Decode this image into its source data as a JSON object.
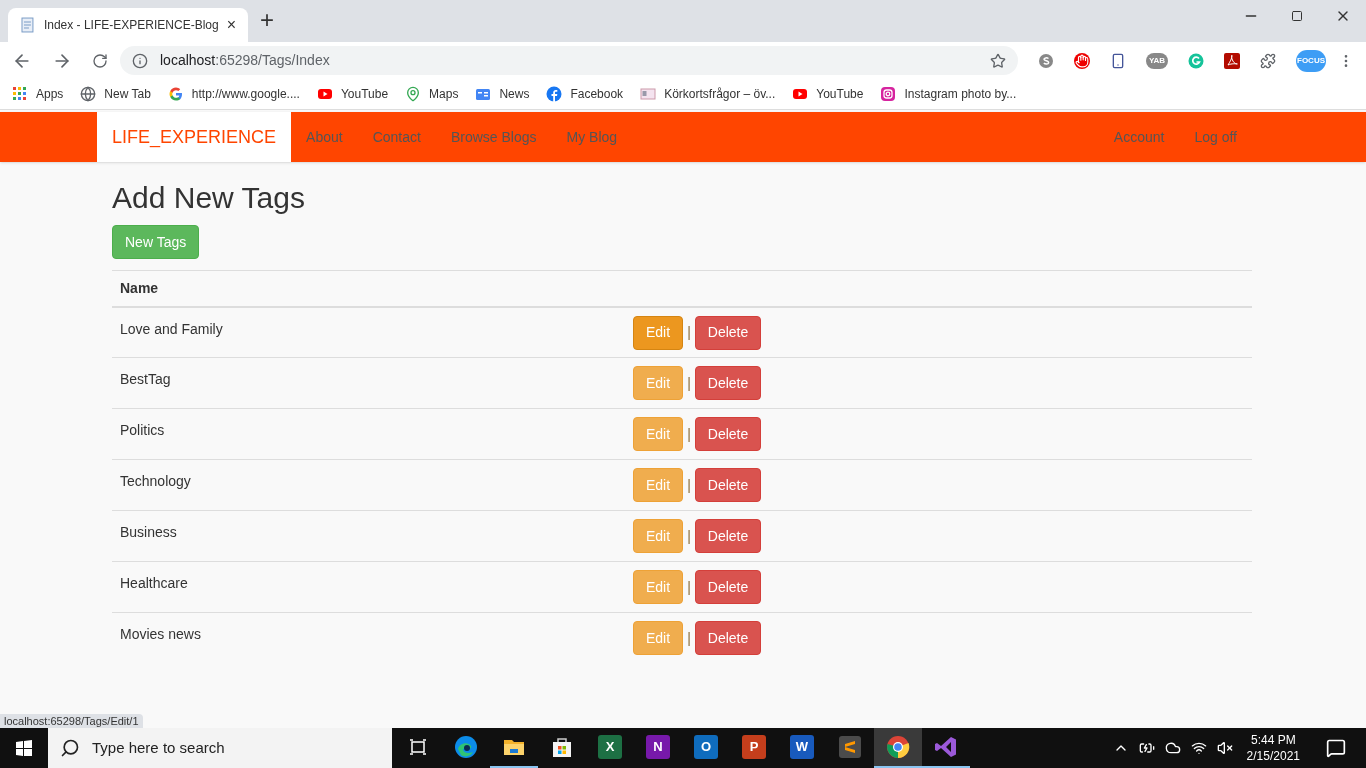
{
  "browser": {
    "tab_title": "Index - LIFE-EXPERIENCE-Blog",
    "tab_close": "×",
    "new_tab": "+",
    "url_host": "localhost",
    "url_rest": ":65298/Tags/Index",
    "profile_badge": "FOCUS",
    "yab_badge": "YAB"
  },
  "bookmarks": [
    {
      "kind": "apps",
      "label": "Apps"
    },
    {
      "kind": "globe",
      "label": "New Tab"
    },
    {
      "kind": "google",
      "label": "http://www.google...."
    },
    {
      "kind": "youtube",
      "label": "YouTube"
    },
    {
      "kind": "maps",
      "label": "Maps"
    },
    {
      "kind": "news",
      "label": "News"
    },
    {
      "kind": "facebook",
      "label": "Facebook"
    },
    {
      "kind": "card",
      "label": "Körkortsfrågor – öv..."
    },
    {
      "kind": "youtube",
      "label": "YouTube"
    },
    {
      "kind": "instagram",
      "label": "Instagram photo by..."
    }
  ],
  "navbar": {
    "brand": "LIFE_EXPERIENCE",
    "links": [
      "About",
      "Contact",
      "Browse Blogs",
      "My Blog"
    ],
    "right_links": [
      "Account",
      "Log off"
    ]
  },
  "page": {
    "heading": "Add New Tags",
    "new_button": "New Tags",
    "column": "Name",
    "separator": "|",
    "rows": [
      {
        "name": "Love and Family",
        "edit": "Edit",
        "delete": "Delete",
        "hovered": true
      },
      {
        "name": "BestTag",
        "edit": "Edit",
        "delete": "Delete",
        "hovered": false
      },
      {
        "name": "Politics",
        "edit": "Edit",
        "delete": "Delete",
        "hovered": false
      },
      {
        "name": "Technology",
        "edit": "Edit",
        "delete": "Delete",
        "hovered": false
      },
      {
        "name": "Business",
        "edit": "Edit",
        "delete": "Delete",
        "hovered": false
      },
      {
        "name": "Healthcare",
        "edit": "Edit",
        "delete": "Delete",
        "hovered": false
      },
      {
        "name": "Movies news",
        "edit": "Edit",
        "delete": "Delete",
        "hovered": false
      }
    ]
  },
  "status_url": "localhost:65298/Tags/Edit/1",
  "taskbar": {
    "search_placeholder": "Type here to search",
    "apps": [
      {
        "kind": "taskview",
        "active": false
      },
      {
        "kind": "edge",
        "active": false
      },
      {
        "kind": "folder",
        "active": true
      },
      {
        "kind": "store",
        "active": false
      },
      {
        "kind": "tile",
        "letter": "X",
        "color": "#1d7044",
        "active": false
      },
      {
        "kind": "tile",
        "letter": "N",
        "color": "#7719aa",
        "active": false
      },
      {
        "kind": "tile",
        "letter": "O",
        "color": "#0f6cbd",
        "active": false
      },
      {
        "kind": "tile",
        "letter": "P",
        "color": "#c43e1c",
        "active": false
      },
      {
        "kind": "tile",
        "letter": "W",
        "color": "#185abd",
        "active": false
      },
      {
        "kind": "sublime",
        "active": false
      },
      {
        "kind": "chrome",
        "active": true
      },
      {
        "kind": "vs",
        "active": true
      }
    ],
    "time": "5:44 PM",
    "date": "2/15/2021"
  }
}
